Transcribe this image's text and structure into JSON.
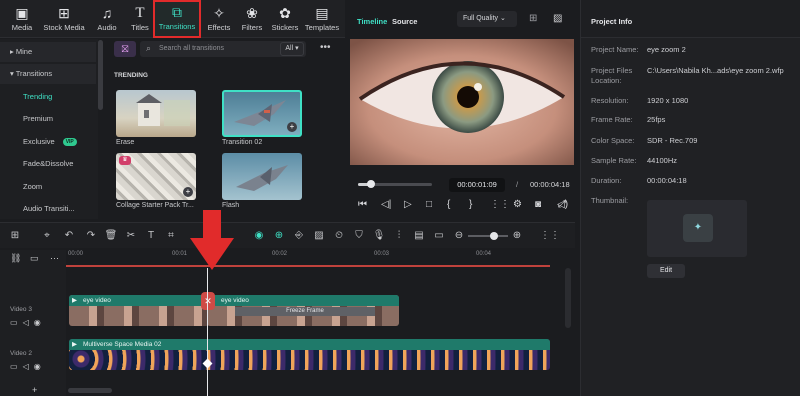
{
  "toolbar": {
    "items": [
      {
        "label": "Media",
        "icon": "media-icon"
      },
      {
        "label": "Stock Media",
        "icon": "stock-media-icon"
      },
      {
        "label": "Audio",
        "icon": "audio-icon"
      },
      {
        "label": "Titles",
        "icon": "titles-icon"
      },
      {
        "label": "Transitions",
        "icon": "transitions-icon"
      },
      {
        "label": "Effects",
        "icon": "effects-icon"
      },
      {
        "label": "Filters",
        "icon": "filters-icon"
      },
      {
        "label": "Stickers",
        "icon": "stickers-icon"
      },
      {
        "label": "Templates",
        "icon": "templates-icon"
      }
    ],
    "active": "Transitions",
    "highlight_color": "#e12b2b",
    "accent_color": "#3fe0c5"
  },
  "categories": {
    "mine": "Mine",
    "transitions": "Transitions",
    "items": [
      "Trending",
      "Premium",
      "Exclusive",
      "Fade&Dissolve",
      "Zoom",
      "Audio Transiti..."
    ],
    "selected": "Trending",
    "exclusive_badge": "VIP"
  },
  "search": {
    "placeholder": "Search all transitions",
    "filter_label": "All"
  },
  "assets": {
    "section": "TRENDING",
    "items": [
      "Erase",
      "Transition 02",
      "Collage Starter Pack Tr...",
      "Flash"
    ]
  },
  "preview": {
    "tab_timeline": "Timeline",
    "tab_source": "Source",
    "quality": "Full Quality",
    "current_time": "00:00:01:09",
    "separator": "/",
    "total_time": "00:00:04:18",
    "scrub_progress": 0.18
  },
  "project_info": {
    "title": "Project Info",
    "fields": [
      {
        "key": "Project Name:",
        "value": "eye zoom 2"
      },
      {
        "key": "Project Files",
        "key2": "Location:",
        "value": "C:\\Users\\Nabila Kh...ads\\eye zoom 2.wfp"
      },
      {
        "key": "Resolution:",
        "value": "1920 x 1080"
      },
      {
        "key": "Frame Rate:",
        "value": "25fps"
      },
      {
        "key": "Color Space:",
        "value": "SDR - Rec.709"
      },
      {
        "key": "Sample Rate:",
        "value": "44100Hz"
      },
      {
        "key": "Duration:",
        "value": "00:00:04:18"
      },
      {
        "key": "Thumbnail:",
        "value": ""
      }
    ],
    "edit_label": "Edit"
  },
  "timeline": {
    "ruler": [
      "00:00",
      "00:01",
      "00:02",
      "00:03",
      "00:04"
    ],
    "tracks": [
      {
        "name": "Video 3"
      },
      {
        "name": "Video 2"
      }
    ],
    "clips": {
      "eye1": "eye video",
      "eye2": "eye video",
      "freeze": "Freeze Frame",
      "space": "Multiverse Space Media 02"
    }
  }
}
